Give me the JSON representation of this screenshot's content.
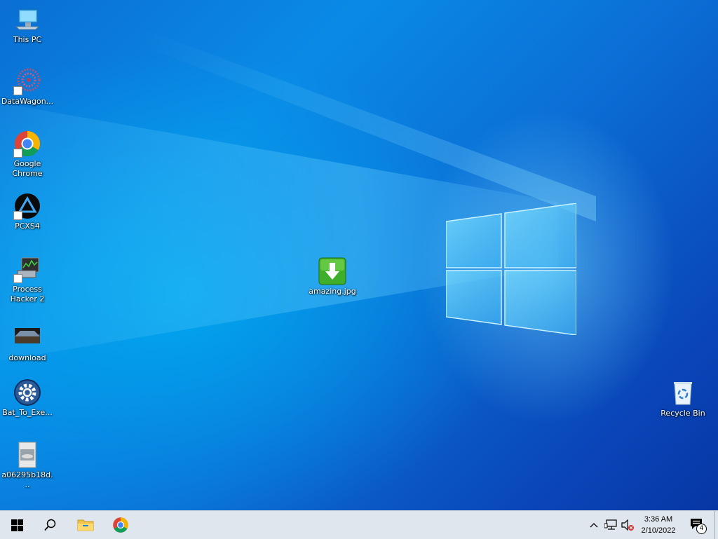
{
  "desktop": {
    "icons": [
      {
        "label": "This PC",
        "icon": "this-pc-icon"
      },
      {
        "label": "DataWagon...",
        "icon": "datawagon-icon"
      },
      {
        "label": "Google Chrome",
        "icon": "chrome-icon"
      },
      {
        "label": "PCXS4",
        "icon": "pcxs4-icon"
      },
      {
        "label": "Process Hacker 2",
        "icon": "process-hacker-icon"
      },
      {
        "label": "download",
        "icon": "download-image-icon"
      },
      {
        "label": "Bat_To_Exe...",
        "icon": "gear-icon"
      },
      {
        "label": "a06295b18d...",
        "icon": "image-file-icon"
      },
      {
        "label": "amazing.jpg",
        "icon": "green-download-icon"
      },
      {
        "label": "Recycle Bin",
        "icon": "recycle-bin-icon"
      }
    ]
  },
  "taskbar": {
    "start": "windows-start-icon",
    "search": "search-icon",
    "pinned": [
      "file-explorer-icon",
      "chrome-icon"
    ],
    "tray": {
      "time": "3:36 AM",
      "date": "2/10/2022",
      "notification_count": "4"
    }
  }
}
